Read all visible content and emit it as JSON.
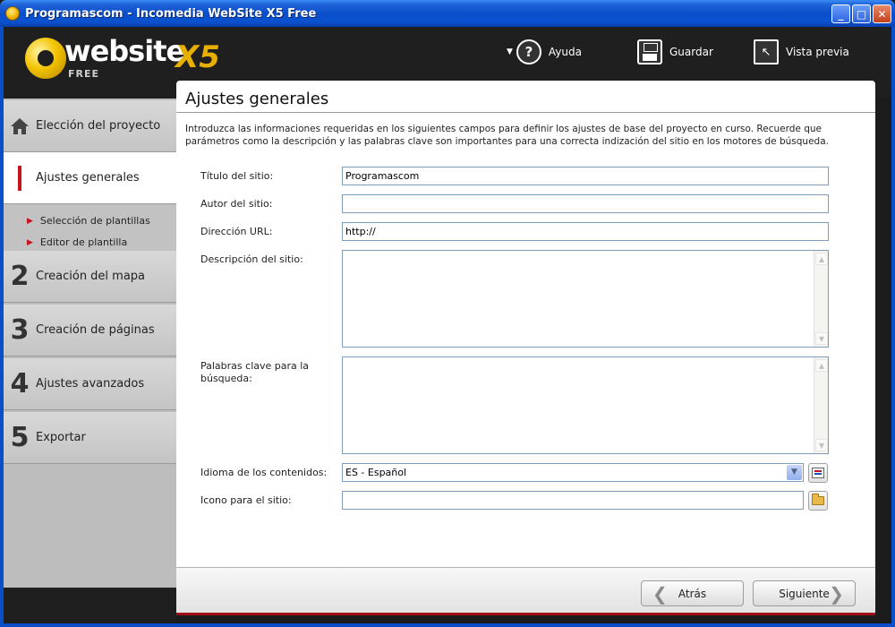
{
  "window": {
    "title": "Programascom - Incomedia WebSite X5 Free"
  },
  "logo": {
    "word": "website",
    "version": "X5",
    "edition": "FREE"
  },
  "toolbar": {
    "help_label": "Ayuda",
    "save_label": "Guardar",
    "preview_label": "Vista previa"
  },
  "sidebar": {
    "items": [
      {
        "num": "",
        "label": "Elección del proyecto"
      },
      {
        "num": "",
        "label": "Ajustes generales"
      },
      {
        "num": "2",
        "label": "Creación del mapa"
      },
      {
        "num": "3",
        "label": "Creación de páginas"
      },
      {
        "num": "4",
        "label": "Ajustes avanzados"
      },
      {
        "num": "5",
        "label": "Exportar"
      }
    ],
    "sub_items": [
      "Selección de plantillas",
      "Editor de plantilla"
    ]
  },
  "main": {
    "title": "Ajustes generales",
    "description": "Introduzca las informaciones requeridas en los siguientes campos para definir los ajustes de base del proyecto en curso. Recuerde que parámetros como la descripción y las palabras clave son importantes para una correcta indización del sitio en los motores de búsqueda.",
    "fields": {
      "site_title": {
        "label": "Título del sitio:",
        "value": "Programascom"
      },
      "site_author": {
        "label": "Autor del sitio:",
        "value": ""
      },
      "url": {
        "label": "Dirección URL:",
        "value": "http://"
      },
      "description": {
        "label": "Descripción del sitio:",
        "value": ""
      },
      "keywords": {
        "label": "Palabras clave para la búsqueda:",
        "value": ""
      },
      "language": {
        "label": "Idioma de los contenidos:",
        "value": "ES - Español"
      },
      "icon": {
        "label": "Icono para el sitio:",
        "value": ""
      }
    }
  },
  "nav": {
    "back_label": "Atrás",
    "next_label": "Siguiente"
  },
  "colors": {
    "accent_red": "#c4141c",
    "titlebar_blue": "#0a4ec9",
    "header_dark": "#1f1f1f"
  }
}
